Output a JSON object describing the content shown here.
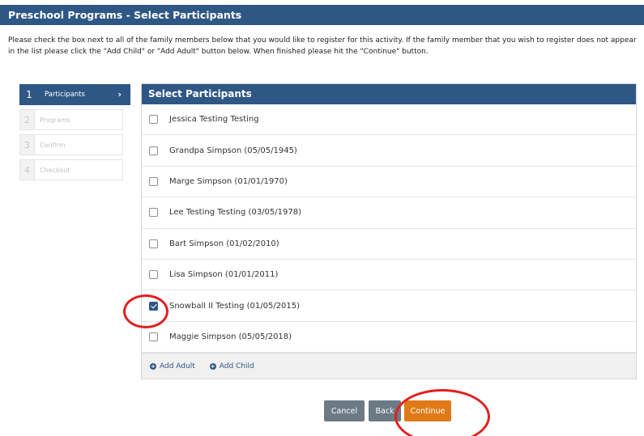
{
  "header": {
    "title": "Preschool Programs - Select Participants"
  },
  "instructions": "Please check the box next to all of the family members below that you would like to register for this activity. If the family member that you wish to register does not appear in the list please click the \"Add Child\" or \"Add Adult\" button below. When finished please hit the \"Continue\" button.",
  "steps": [
    {
      "num": "1",
      "label": "Participants",
      "active": true
    },
    {
      "num": "2",
      "label": "Programs",
      "active": false
    },
    {
      "num": "3",
      "label": "Confirm",
      "active": false
    },
    {
      "num": "4",
      "label": "Checkout",
      "active": false
    }
  ],
  "panel": {
    "title": "Select Participants",
    "participants": [
      {
        "name": "Jessica Testing Testing",
        "checked": false
      },
      {
        "name": "Grandpa Simpson (05/05/1945)",
        "checked": false
      },
      {
        "name": "Marge Simpson (01/01/1970)",
        "checked": false
      },
      {
        "name": "Lee Testing Testing (03/05/1978)",
        "checked": false
      },
      {
        "name": "Bart Simpson (01/02/2010)",
        "checked": false
      },
      {
        "name": "Lisa Simpson (01/01/2011)",
        "checked": false
      },
      {
        "name": "Snowball II Testing (01/05/2015)",
        "checked": true
      },
      {
        "name": "Maggie Simpson (05/05/2018)",
        "checked": false
      }
    ],
    "add_adult": "Add Adult",
    "add_child": "Add Child"
  },
  "buttons": {
    "cancel": "Cancel",
    "back": "Back",
    "continue": "Continue"
  },
  "colors": {
    "primary": "#2f5785",
    "accent": "#e07a18",
    "annotation": "#e02020",
    "secondary_button": "#6c7a86"
  }
}
